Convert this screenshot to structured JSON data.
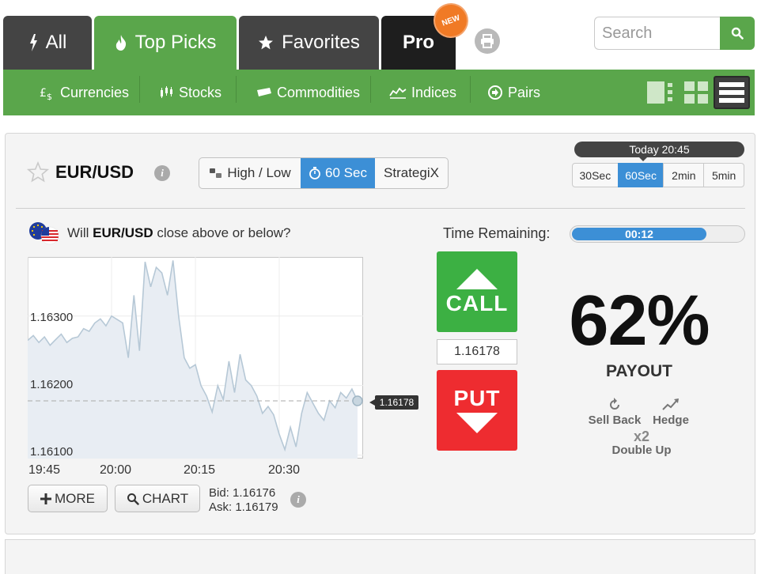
{
  "tabs": [
    {
      "label": "All",
      "icon": "bolt-icon"
    },
    {
      "label": "Top Picks",
      "icon": "flame-icon"
    },
    {
      "label": "Favorites",
      "icon": "star-icon"
    },
    {
      "label": "Pro",
      "badge": "NEW"
    }
  ],
  "search": {
    "placeholder": "Search"
  },
  "categories": [
    {
      "label": "Currencies",
      "icon": "currency-icon"
    },
    {
      "label": "Stocks",
      "icon": "stocks-icon"
    },
    {
      "label": "Commodities",
      "icon": "commodities-icon"
    },
    {
      "label": "Indices",
      "icon": "indices-icon"
    },
    {
      "label": "Pairs",
      "icon": "pairs-icon"
    }
  ],
  "asset": {
    "name": "EUR/USD",
    "question_prefix": "Will ",
    "question_asset": "EUR/USD",
    "question_suffix": " close above or below?"
  },
  "modes": [
    {
      "label": "High / Low",
      "active": false
    },
    {
      "label": "60 Sec",
      "active": true
    },
    {
      "label": "StrategiX",
      "active": false
    }
  ],
  "clock": {
    "label": "Today 20:45"
  },
  "durations": [
    {
      "label": "30Sec",
      "active": false
    },
    {
      "label": "60Sec",
      "active": true
    },
    {
      "label": "2min",
      "active": false
    },
    {
      "label": "5min",
      "active": false
    }
  ],
  "timer": {
    "label": "Time Remaining:",
    "value": "00:12",
    "progress": 0.8
  },
  "trade": {
    "call": "CALL",
    "put": "PUT",
    "strike": "1.16178"
  },
  "payout": {
    "value": "62%",
    "label": "PAYOUT"
  },
  "tools": {
    "sell_back": "Sell Back",
    "hedge": "Hedge",
    "double_up_badge": "x2",
    "double_up": "Double Up"
  },
  "buttons": {
    "more": "MORE",
    "chart": "CHART"
  },
  "quotes": {
    "bid": "Bid: 1.16176",
    "ask": "Ask: 1.16179"
  },
  "chart_data": {
    "type": "area",
    "current_price": "1.16178",
    "y_ticks": [
      "1.16300",
      "1.16200",
      "1.16100"
    ],
    "x_ticks": [
      "19:45",
      "20:00",
      "20:15",
      "20:30"
    ],
    "ylim": [
      1.16095,
      1.16385
    ],
    "x": [
      0,
      0.5,
      1,
      1.5,
      2,
      2.5,
      3,
      3.5,
      4,
      4.5,
      5,
      5.5,
      6,
      6.5,
      7,
      7.5,
      8,
      8.5,
      9,
      9.5,
      10,
      10.5,
      11,
      11.5,
      12,
      12.5,
      13,
      13.5,
      14,
      14.5,
      15,
      15.5,
      16,
      16.5,
      17,
      17.5,
      18,
      18.5,
      19,
      19.5,
      20,
      20.5,
      21,
      21.5,
      22,
      22.5,
      23,
      23.5,
      24,
      24.5,
      25,
      25.5,
      26,
      26.5,
      27,
      27.5,
      28,
      28.5,
      29,
      29.5
    ],
    "values": [
      1.16265,
      1.16272,
      1.16262,
      1.1627,
      1.16258,
      1.16266,
      1.16274,
      1.16262,
      1.16268,
      1.1627,
      1.16282,
      1.16278,
      1.1629,
      1.16296,
      1.16286,
      1.163,
      1.16295,
      1.1629,
      1.1624,
      1.1633,
      1.1625,
      1.16378,
      1.16342,
      1.1637,
      1.16362,
      1.1633,
      1.1638,
      1.163,
      1.1624,
      1.16225,
      1.1623,
      1.162,
      1.16185,
      1.16162,
      1.162,
      1.1618,
      1.16235,
      1.1619,
      1.16245,
      1.16208,
      1.162,
      1.16185,
      1.1616,
      1.1617,
      1.16158,
      1.1613,
      1.16108,
      1.1614,
      1.16112,
      1.1616,
      1.1619,
      1.16175,
      1.1616,
      1.1615,
      1.16178,
      1.16168,
      1.1619,
      1.16182,
      1.16195,
      1.16178
    ],
    "grid": true,
    "xlabel": "",
    "ylabel": ""
  },
  "colors": {
    "green": "#5aa64b",
    "dark_tab": "#444444",
    "blue": "#3c8fd6",
    "call": "#3cb043",
    "put": "#ee2c30"
  }
}
